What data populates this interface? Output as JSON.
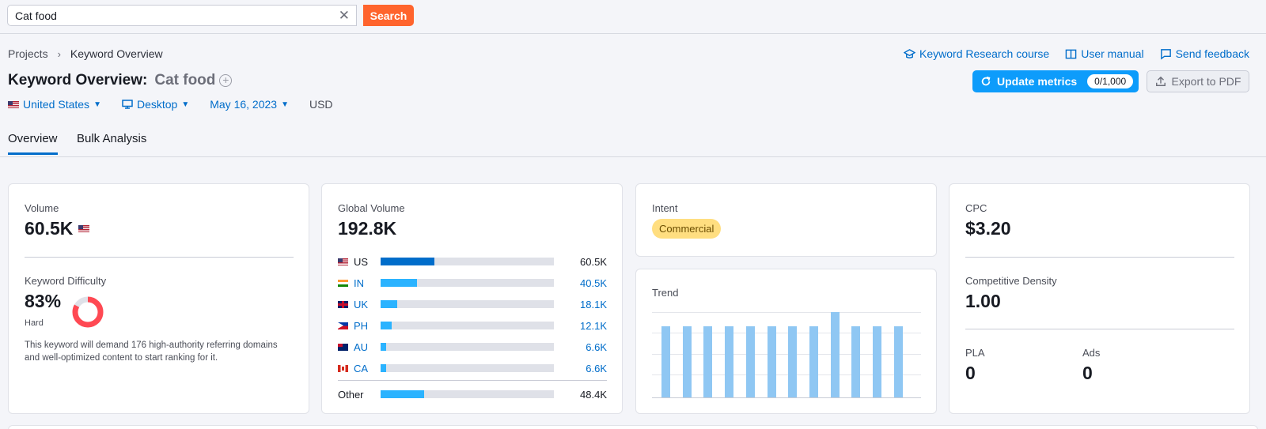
{
  "search": {
    "value": "Cat food",
    "button": "Search"
  },
  "breadcrumb": {
    "items": [
      "Projects",
      "Keyword Overview"
    ]
  },
  "toplinks": [
    {
      "label": "Keyword Research course",
      "icon": "graduation-cap-icon"
    },
    {
      "label": "User manual",
      "icon": "book-icon"
    },
    {
      "label": "Send feedback",
      "icon": "comment-icon"
    }
  ],
  "title": {
    "prefix": "Keyword Overview:",
    "keyword": "Cat food"
  },
  "actions": {
    "update_label": "Update metrics",
    "update_counter": "0/1,000",
    "export_label": "Export to PDF"
  },
  "filters": {
    "country": "United States",
    "device": "Desktop",
    "date": "May 16, 2023",
    "currency": "USD"
  },
  "tabs": [
    "Overview",
    "Bulk Analysis"
  ],
  "volume": {
    "label": "Volume",
    "value": "60.5K"
  },
  "difficulty": {
    "label": "Keyword Difficulty",
    "value": "83%",
    "percent": 83,
    "level": "Hard",
    "description": "This keyword will demand 176 high-authority referring domains and well-optimized content to start ranking for it.",
    "color": "#ff4953"
  },
  "global_volume": {
    "label": "Global Volume",
    "value": "192.8K",
    "countries": [
      {
        "code": "US",
        "value": "60.5K",
        "share": 0.31
      },
      {
        "code": "IN",
        "value": "40.5K",
        "share": 0.21
      },
      {
        "code": "UK",
        "value": "18.1K",
        "share": 0.094
      },
      {
        "code": "PH",
        "value": "12.1K",
        "share": 0.063
      },
      {
        "code": "AU",
        "value": "6.6K",
        "share": 0.034
      },
      {
        "code": "CA",
        "value": "6.6K",
        "share": 0.034
      }
    ],
    "other": {
      "label": "Other",
      "value": "48.4K",
      "share": 0.25
    }
  },
  "intent": {
    "label": "Intent",
    "value": "Commercial"
  },
  "trend": {
    "label": "Trend",
    "values": [
      0.83,
      0.83,
      0.83,
      0.83,
      0.83,
      0.83,
      0.83,
      0.83,
      1.0,
      0.83,
      0.83,
      0.83
    ]
  },
  "cpc": {
    "label": "CPC",
    "value": "$3.20"
  },
  "competitive_density": {
    "label": "Competitive Density",
    "value": "1.00"
  },
  "pla": {
    "label": "PLA",
    "value": "0"
  },
  "ads": {
    "label": "Ads",
    "value": "0"
  }
}
